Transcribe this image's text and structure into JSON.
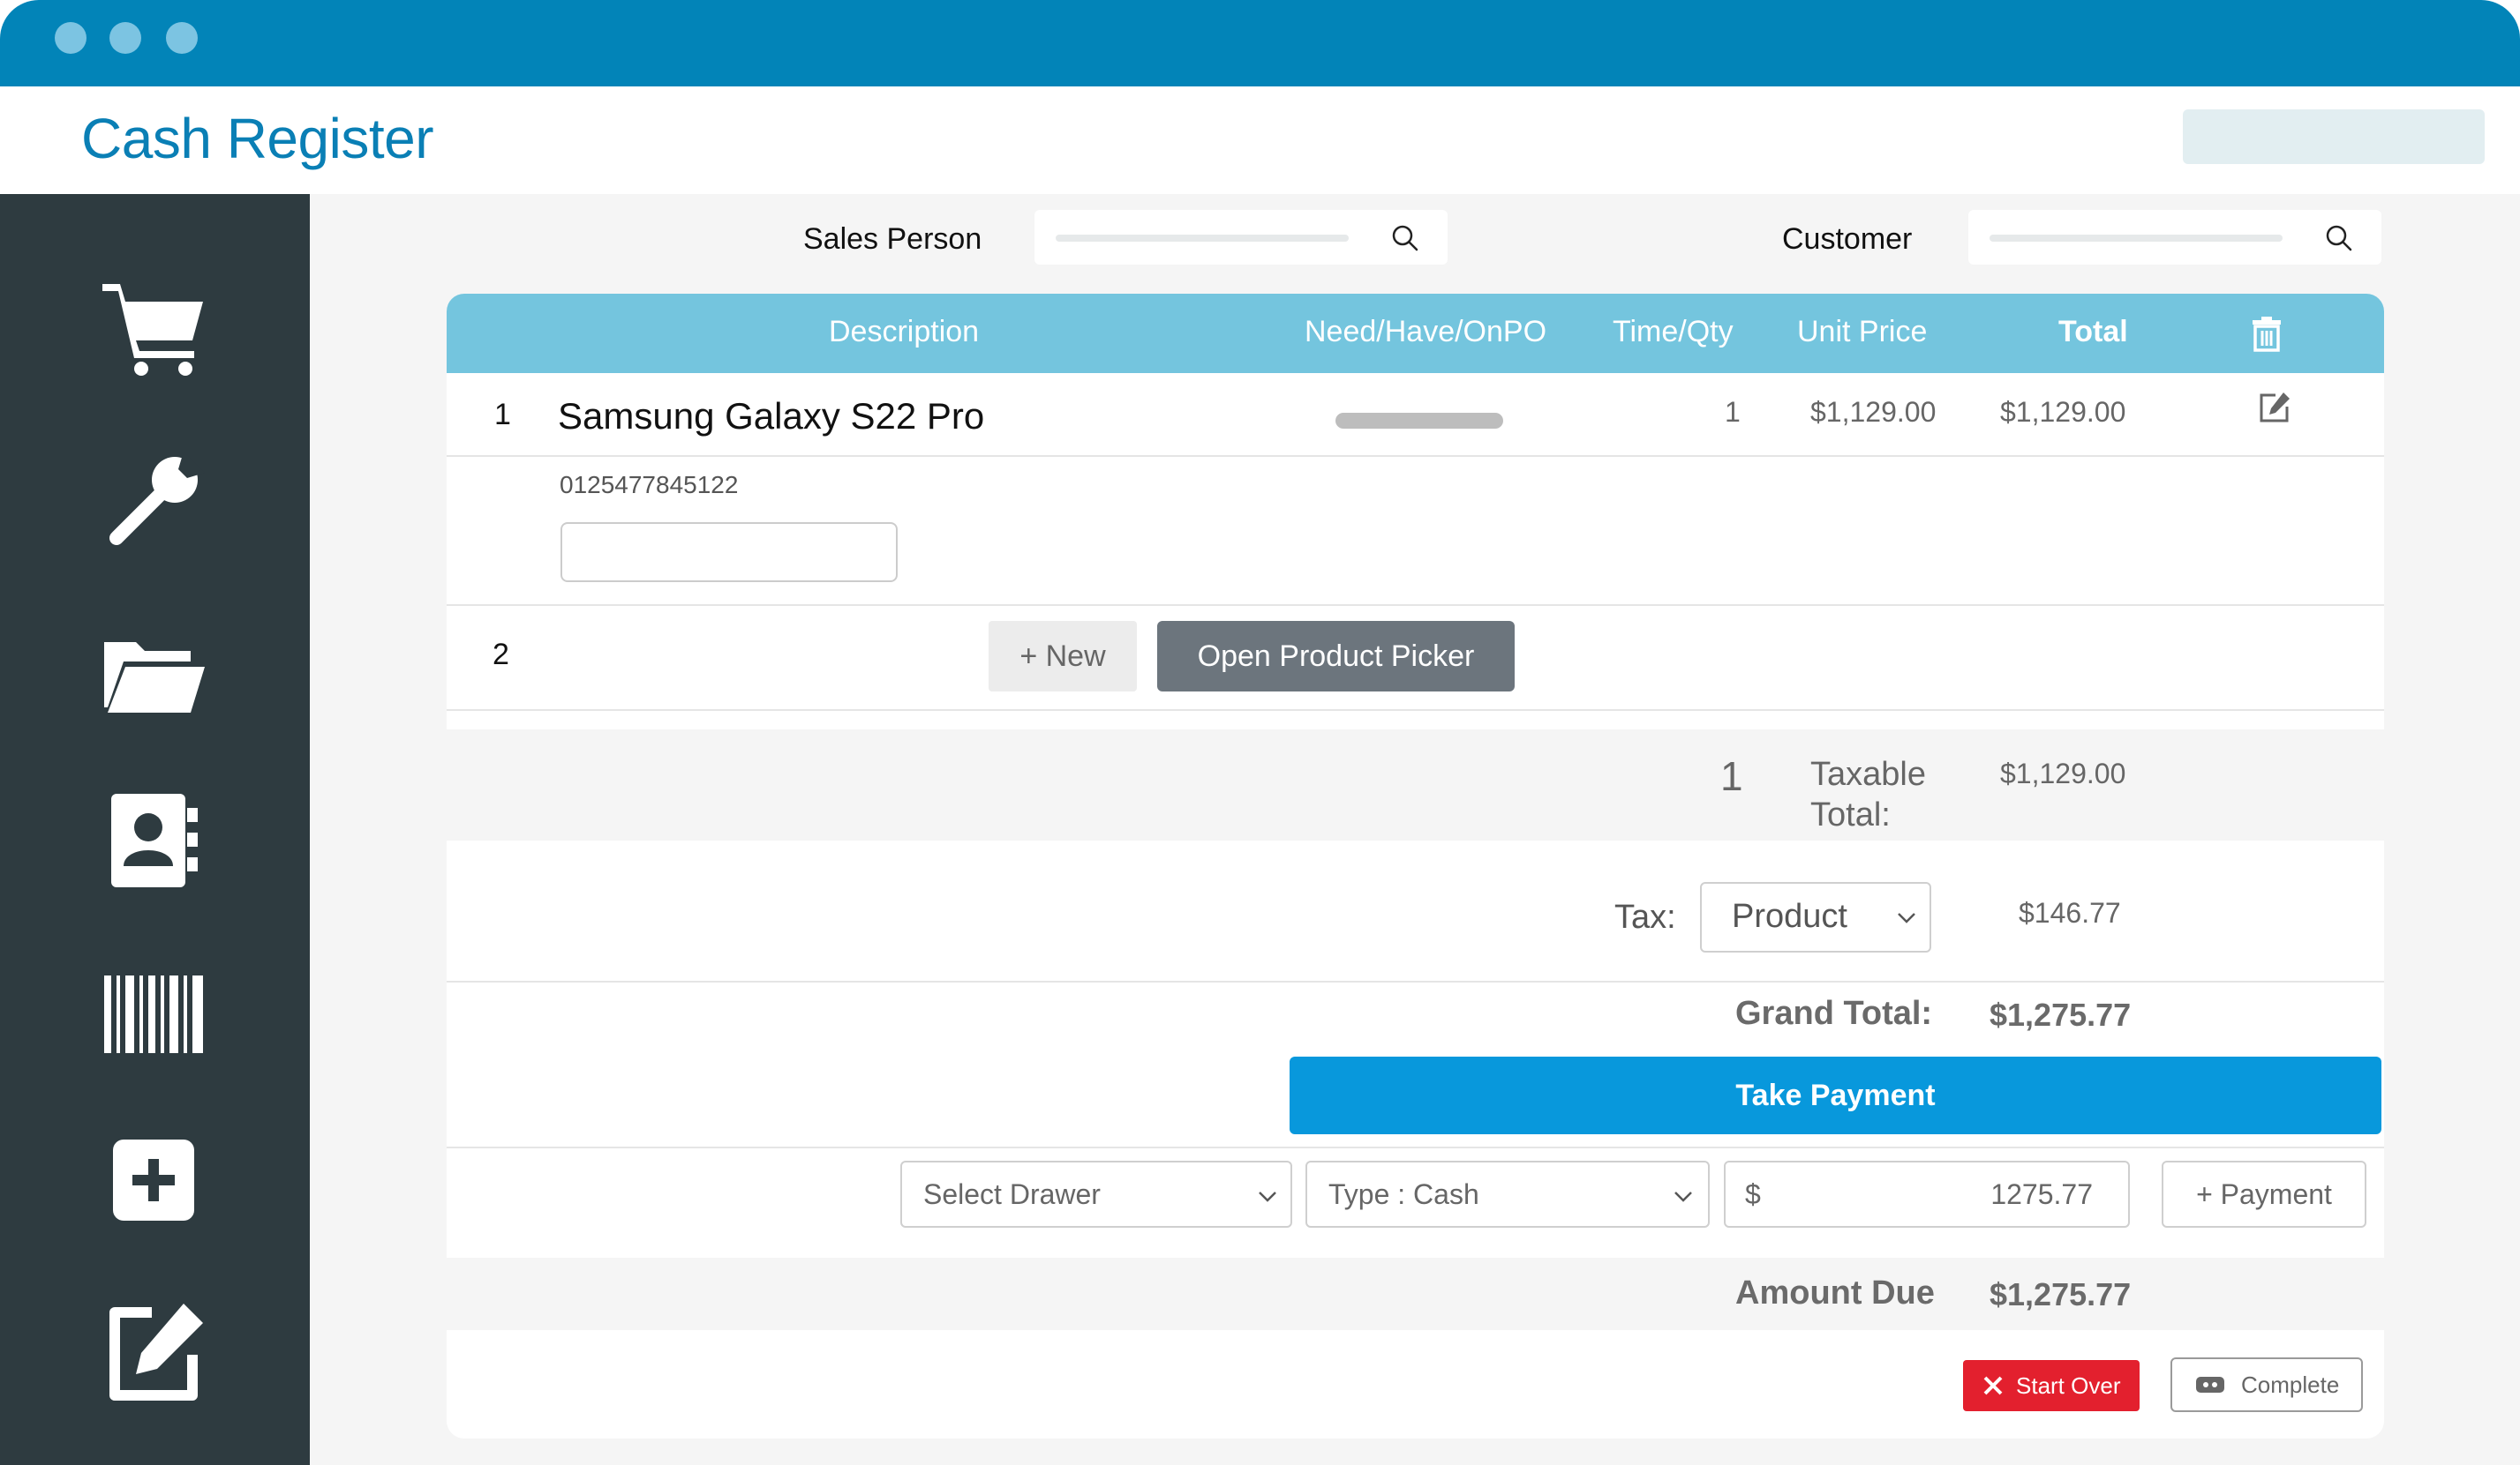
{
  "window": {
    "title": "Cash Register"
  },
  "sidebar": {
    "items": [
      {
        "icon": "cart-icon",
        "label": ""
      },
      {
        "icon": "wrench-icon",
        "label": ""
      },
      {
        "icon": "folder-icon",
        "label": ""
      },
      {
        "icon": "contacts-icon",
        "label": ""
      },
      {
        "icon": "barcode-icon",
        "label": ""
      },
      {
        "icon": "plus-box-icon",
        "label": ""
      },
      {
        "icon": "edit-icon",
        "label": ""
      }
    ]
  },
  "search": {
    "sales_person_label": "Sales Person",
    "customer_label": "Customer"
  },
  "table": {
    "headers": {
      "description": "Description",
      "need_have_onpo": "Need/Have/OnPO",
      "time_qty": "Time/Qty",
      "unit_price": "Unit Price",
      "total": "Total"
    },
    "rows": [
      {
        "index": "1",
        "name": "Samsung Galaxy S22 Pro",
        "qty": "1",
        "unit_price": "$1,129.00",
        "total": "$1,129.00",
        "serial": "0125477845122"
      },
      {
        "index": "2",
        "new_label": "+ New",
        "picker_label": "Open Product Picker"
      }
    ]
  },
  "summary": {
    "taxable_count": "1",
    "taxable_label": "Taxable Total:",
    "taxable_value": "$1,129.00",
    "tax_label": "Tax:",
    "tax_select": "Product",
    "tax_value": "$146.77",
    "grand_total_label": "Grand Total:",
    "grand_total_value": "$1,275.77",
    "take_payment_label": "Take Payment"
  },
  "payment": {
    "drawer_select": "Select Drawer",
    "type_select": "Type : Cash",
    "currency_symbol": "$",
    "amount": "1275.77",
    "add_payment_label": "+ Payment"
  },
  "due": {
    "label": "Amount Due",
    "value": "$1,275.77"
  },
  "actions": {
    "start_over": "Start Over",
    "complete": "Complete"
  },
  "colors": {
    "titlebar": "#0284b8",
    "sidebar": "#2e3b40",
    "table_header": "#74c5de",
    "take_payment": "#0898dc",
    "start_over": "#e3202e"
  }
}
